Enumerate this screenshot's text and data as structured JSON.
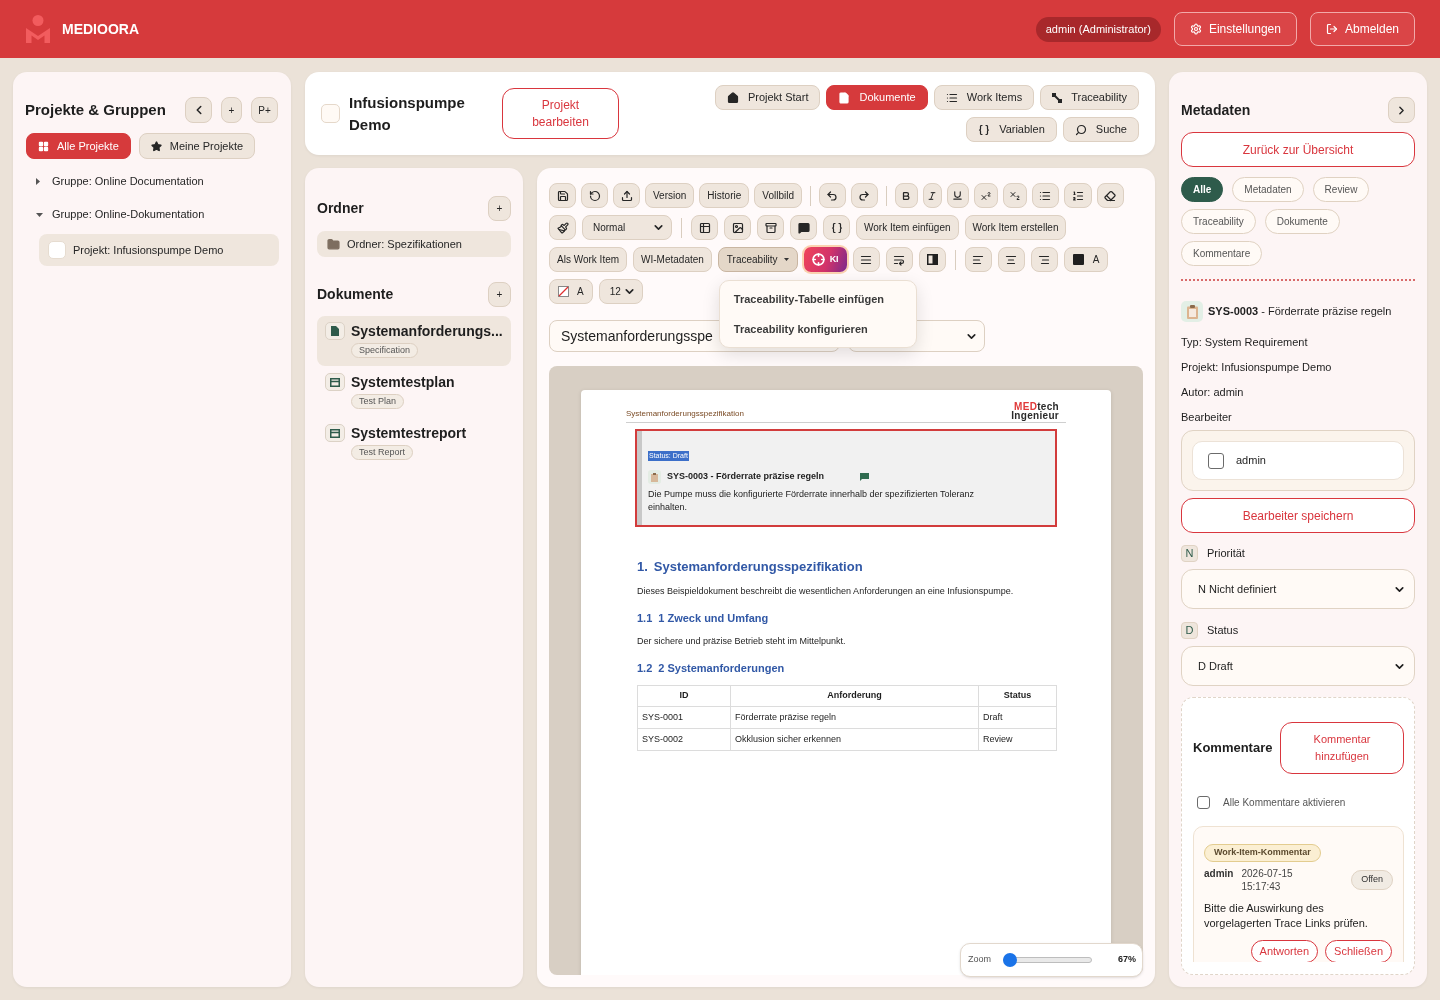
{
  "app_header": {
    "brand": "MEDIOORA",
    "user_badge": "admin (Administrator)",
    "buttons": [
      "Einstellungen",
      "Abmelden"
    ]
  },
  "projects_panel": {
    "title": "Projekte & Gruppen",
    "header_buttons": [
      "+",
      "P+"
    ],
    "filter_tabs": [
      {
        "label": "Alle Projekte",
        "selected": true
      },
      {
        "label": "Meine Projekte",
        "selected": false
      }
    ],
    "tree": [
      {
        "label": "Gruppe: Online Documentation",
        "expanded": false
      },
      {
        "label": "Gruppe: Online-Dokumentation",
        "expanded": true,
        "children": [
          {
            "label": "Projekt: Infusionspumpe Demo",
            "selected": true
          }
        ]
      }
    ]
  },
  "project_header": {
    "title": "Infusionspumpe Demo",
    "edit_button": "Projekt bearbeiten",
    "nav": [
      {
        "label": "Projekt Start",
        "selected": false
      },
      {
        "label": "Dokumente",
        "selected": true
      },
      {
        "label": "Work Items",
        "selected": false
      },
      {
        "label": "Traceability",
        "selected": false
      },
      {
        "label": "Variablen",
        "selected": false
      },
      {
        "label": "Suche",
        "selected": false
      }
    ]
  },
  "folders_panel": {
    "folders_title": "Ordner",
    "folders_add": "+",
    "folders": [
      {
        "label": "Ordner: Spezifikationen"
      }
    ],
    "documents_title": "Dokumente",
    "documents_add": "+",
    "documents": [
      {
        "title": "Systemanforderungs...",
        "type": "Specification",
        "kind": "spec",
        "selected": true
      },
      {
        "title": "Systemtestplan",
        "type": "Test Plan",
        "kind": "test",
        "selected": false
      },
      {
        "title": "Systemtestreport",
        "type": "Test Report",
        "kind": "test",
        "selected": false
      }
    ]
  },
  "editor": {
    "toolbar": {
      "text_buttons": [
        "Version",
        "Historie",
        "Vollbild",
        "Work Item einfügen",
        "Work Item erstellen",
        "Als Work Item",
        "WI-Metadaten"
      ],
      "style_select": "Normal",
      "traceability_menu": {
        "label": "Traceability",
        "expanded": true,
        "items": [
          "Traceability-Tabelle einfügen",
          "Traceability konfigurieren"
        ]
      },
      "ai_button": "KI",
      "text_color_label": "A",
      "highlight_label": "A",
      "font_size_select": "12"
    },
    "document_select": "Systemanforderungsspe",
    "page": {
      "running_header": "Systemanforderungsspezifikation",
      "logo": {
        "accent": "MED",
        "rest": "tech",
        "line_2": "Ingenieur"
      },
      "work_item": {
        "status": "Status: Draft",
        "title": "SYS-0003 - Förderrate präzise regeln",
        "text": "Die Pumpe muss die konfigurierte Förderrate innerhalb der spezifizierten Toleranz einhalten."
      },
      "sections": [
        {
          "kind": "heading1",
          "number": "1.",
          "text": "Systemanforderungsspezifikation"
        },
        {
          "kind": "paragraph",
          "text": "Dieses Beispieldokument beschreibt die wesentlichen Anforderungen an eine Infusionspumpe."
        },
        {
          "kind": "heading2",
          "number": "1.1",
          "text": "1 Zweck und Umfang"
        },
        {
          "kind": "paragraph",
          "text": "Der sichere und präzise Betrieb steht im Mittelpunkt."
        },
        {
          "kind": "heading2",
          "number": "1.2",
          "text": "2 Systemanforderungen"
        },
        {
          "kind": "table",
          "columns": [
            "ID",
            "Anforderung",
            "Status"
          ],
          "rows": [
            [
              "SYS-0001",
              "Förderrate präzise regeln",
              "Draft"
            ],
            [
              "SYS-0002",
              "Okklusion sicher erkennen",
              "Review"
            ]
          ]
        }
      ]
    },
    "zoom": {
      "label": "Zoom",
      "level": 0.07,
      "reading": "67%"
    }
  },
  "metadata_panel": {
    "title": "Metadaten",
    "back_button": "Zurück zur Übersicht",
    "filters": [
      {
        "label": "Alle",
        "selected": true
      },
      {
        "label": "Metadaten",
        "selected": false
      },
      {
        "label": "Review",
        "selected": false
      },
      {
        "label": "Traceability",
        "selected": false
      },
      {
        "label": "Dokumente",
        "selected": false
      },
      {
        "label": "Kommentare",
        "selected": false
      }
    ],
    "work_item": "**SYS-0003** - Förderrate präzise regeln",
    "fields": [
      "Typ: System Requirement",
      "Projekt: Infusionspumpe Demo",
      "Autor: admin"
    ],
    "assignee_label": "Bearbeiter",
    "assignees": [
      {
        "name": "admin",
        "checked": false
      }
    ],
    "save_assignees": "Bearbeiter speichern",
    "priority": {
      "badge": "N",
      "label": "Priorität",
      "value": "N Nicht definiert"
    },
    "status": {
      "badge": "D",
      "label": "Status",
      "value": "D Draft"
    },
    "comments": {
      "title": "Kommentare",
      "add_button": "Kommentar hinzufügen",
      "enable_all": {
        "label": "Alle Kommentare aktivieren",
        "checked": false
      },
      "items": [
        {
          "tag": "Work-Item-Kommentar",
          "author": "admin",
          "timestamp": "2026-07-15 15:17:43",
          "status": "Offen",
          "text": "Bitte die Auswirkung des vorgelagerten Trace Links prüfen.",
          "actions": [
            "Antworten",
            "Schließen"
          ]
        }
      ]
    }
  }
}
